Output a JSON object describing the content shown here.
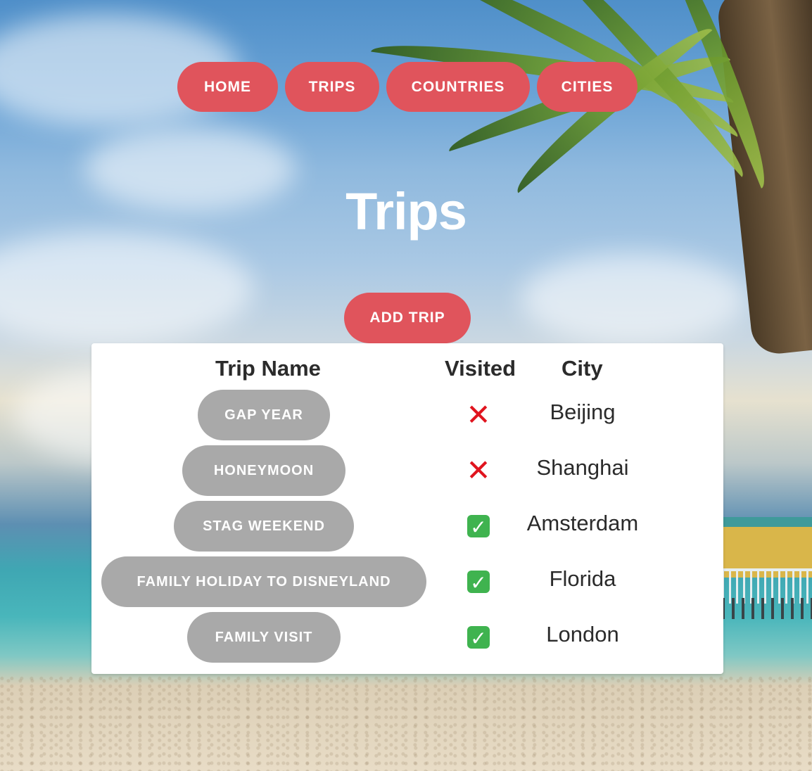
{
  "nav": {
    "home": "HOME",
    "trips": "TRIPS",
    "countries": "COUNTRIES",
    "cities": "CITIES"
  },
  "page": {
    "title": "Trips",
    "add_trip_label": "ADD TRIP"
  },
  "table": {
    "headers": {
      "trip_name": "Trip Name",
      "visited": "Visited",
      "city": "City"
    },
    "rows": [
      {
        "name": "GAP YEAR",
        "visited": false,
        "visited_icon": "cross-mark-icon",
        "city": "Beijing"
      },
      {
        "name": "HONEYMOON",
        "visited": false,
        "visited_icon": "cross-mark-icon",
        "city": "Shanghai"
      },
      {
        "name": "STAG WEEKEND",
        "visited": true,
        "visited_icon": "check-mark-icon",
        "city": "Amsterdam"
      },
      {
        "name": "FAMILY HOLIDAY TO DISNEYLAND",
        "visited": true,
        "visited_icon": "check-mark-icon",
        "city": "Florida"
      },
      {
        "name": "FAMILY VISIT",
        "visited": true,
        "visited_icon": "check-mark-icon",
        "city": "London"
      }
    ]
  },
  "colors": {
    "accent": "#e0545c",
    "trip_button": "#a9a9a9",
    "cross": "#e0141e",
    "check": "#3fb34f"
  }
}
